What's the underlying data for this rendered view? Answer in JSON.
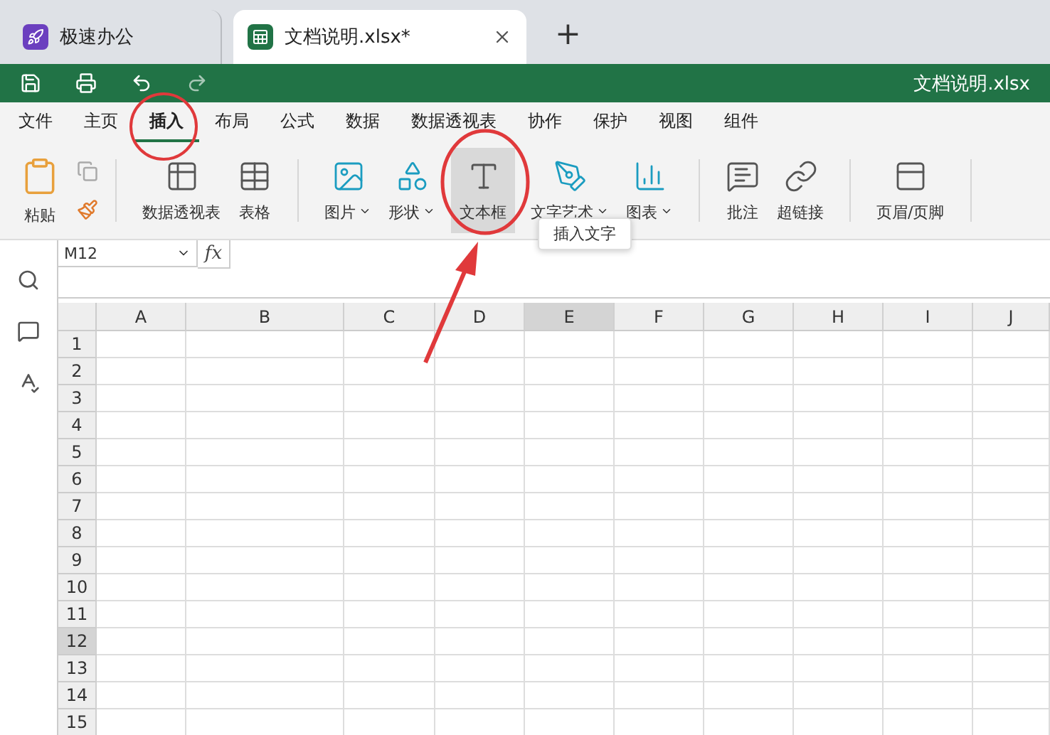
{
  "tabs": [
    {
      "label": "极速办公",
      "selected": false,
      "closable": false
    },
    {
      "label": "文档说明.xlsx*",
      "selected": true,
      "closable": true
    }
  ],
  "new_tab": "+",
  "quick_bar": {
    "file_name": "文档说明.xlsx"
  },
  "menu": [
    {
      "label": "文件",
      "selected": false
    },
    {
      "label": "主页",
      "selected": false
    },
    {
      "label": "插入",
      "selected": true
    },
    {
      "label": "布局",
      "selected": false
    },
    {
      "label": "公式",
      "selected": false
    },
    {
      "label": "数据",
      "selected": false
    },
    {
      "label": "数据透视表",
      "selected": false
    },
    {
      "label": "协作",
      "selected": false
    },
    {
      "label": "保护",
      "selected": false
    },
    {
      "label": "视图",
      "selected": false
    },
    {
      "label": "组件",
      "selected": false
    }
  ],
  "ribbon": [
    {
      "kind": "clipboard",
      "label": "粘贴"
    },
    {
      "kind": "divider"
    },
    {
      "kind": "button",
      "label": "数据透视表",
      "dropdown": false,
      "selected": false
    },
    {
      "kind": "button",
      "label": "表格",
      "dropdown": false,
      "selected": false
    },
    {
      "kind": "divider"
    },
    {
      "kind": "button",
      "label": "图片",
      "dropdown": true,
      "selected": false
    },
    {
      "kind": "button",
      "label": "形状",
      "dropdown": true,
      "selected": false
    },
    {
      "kind": "button",
      "label": "文本框",
      "dropdown": false,
      "selected": true
    },
    {
      "kind": "button",
      "label": "文字艺术",
      "dropdown": true,
      "selected": false
    },
    {
      "kind": "button",
      "label": "图表",
      "dropdown": true,
      "selected": false
    },
    {
      "kind": "divider"
    },
    {
      "kind": "button",
      "label": "批注",
      "dropdown": false,
      "selected": false
    },
    {
      "kind": "button",
      "label": "超链接",
      "dropdown": false,
      "selected": false
    },
    {
      "kind": "divider"
    },
    {
      "kind": "button",
      "label": "页眉/页脚",
      "dropdown": false,
      "selected": false
    },
    {
      "kind": "divider"
    }
  ],
  "tooltip": "插入文字",
  "formula_bar": {
    "cell_ref": "M12",
    "fx": "fx"
  },
  "sheet": {
    "columns": [
      {
        "label": "A",
        "selected": false
      },
      {
        "label": "B",
        "selected": false
      },
      {
        "label": "C",
        "selected": false
      },
      {
        "label": "D",
        "selected": false
      },
      {
        "label": "E",
        "selected": true
      },
      {
        "label": "F",
        "selected": false
      },
      {
        "label": "G",
        "selected": false
      },
      {
        "label": "H",
        "selected": false
      },
      {
        "label": "I",
        "selected": false
      },
      {
        "label": "J",
        "selected": false
      }
    ],
    "rows": [
      {
        "label": "1",
        "selected": false
      },
      {
        "label": "2",
        "selected": false
      },
      {
        "label": "3",
        "selected": false
      },
      {
        "label": "4",
        "selected": false
      },
      {
        "label": "5",
        "selected": false
      },
      {
        "label": "6",
        "selected": false
      },
      {
        "label": "7",
        "selected": false
      },
      {
        "label": "8",
        "selected": false
      },
      {
        "label": "9",
        "selected": false
      },
      {
        "label": "10",
        "selected": false
      },
      {
        "label": "11",
        "selected": false
      },
      {
        "label": "12",
        "selected": true
      },
      {
        "label": "13",
        "selected": false
      },
      {
        "label": "14",
        "selected": false
      },
      {
        "label": "15",
        "selected": false
      }
    ]
  }
}
